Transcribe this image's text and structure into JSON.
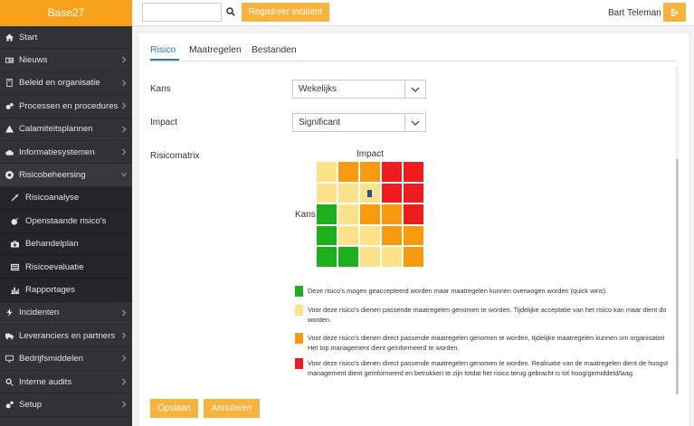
{
  "brand": "Base27",
  "sidebar": {
    "items": [
      {
        "label": "Start",
        "icon": "home-icon",
        "chevron": false
      },
      {
        "label": "Nieuws",
        "icon": "newspaper-icon",
        "chevron": true
      },
      {
        "label": "Beleid en organisatie",
        "icon": "book-icon",
        "chevron": true
      },
      {
        "label": "Processen en procedures",
        "icon": "cogs-icon",
        "chevron": true
      },
      {
        "label": "Calamiteitsplannen",
        "icon": "warning-icon",
        "chevron": true
      },
      {
        "label": "Informatiesystemen",
        "icon": "cloud-icon",
        "chevron": true
      },
      {
        "label": "Risicobeheersing",
        "icon": "lifebuoy-icon",
        "chevron": true,
        "open": true
      }
    ],
    "subitems": [
      {
        "label": "Risicoanalyse",
        "icon": "eyedropper-icon"
      },
      {
        "label": "Openstaande risico's",
        "icon": "bomb-icon"
      },
      {
        "label": "Behandelplan",
        "icon": "medkit-icon"
      },
      {
        "label": "Risicoevaluatie",
        "icon": "list-icon"
      },
      {
        "label": "Rapportages",
        "icon": "chart-icon"
      }
    ],
    "items_after": [
      {
        "label": "Incidenten",
        "icon": "bolt-icon",
        "chevron": true
      },
      {
        "label": "Leveranciers en partners",
        "icon": "truck-icon",
        "chevron": true
      },
      {
        "label": "Bedrijfsmiddelen",
        "icon": "desktop-icon",
        "chevron": true
      },
      {
        "label": "Interne audits",
        "icon": "search-icon",
        "chevron": true
      },
      {
        "label": "Setup",
        "icon": "gears-icon",
        "chevron": true
      }
    ]
  },
  "topbar": {
    "search_value": "",
    "register_label": "Registreer incident",
    "user_name": "Bart Teleman"
  },
  "tabs": [
    "Risico",
    "Maatregelen",
    "Bestanden"
  ],
  "form": {
    "kans_label": "Kans",
    "kans_value": "Wekelijks",
    "impact_label": "Impact",
    "impact_value": "Significant",
    "matrix_label": "Risicomatrix"
  },
  "matrix": {
    "title": "Impact",
    "ylabel": "Kans",
    "colors": {
      "G": "#1db01d",
      "Y": "#fde28a",
      "O": "#f89a0e",
      "R": "#ee1c1c"
    },
    "rows": [
      [
        "Y",
        "O",
        "O",
        "R",
        "R"
      ],
      [
        "Y",
        "Y",
        "Y",
        "R",
        "R"
      ],
      [
        "G",
        "Y",
        "O",
        "O",
        "R"
      ],
      [
        "G",
        "Y",
        "Y",
        "O",
        "O"
      ],
      [
        "G",
        "G",
        "Y",
        "Y",
        "O"
      ]
    ],
    "marker": {
      "row": 1,
      "col": 2
    }
  },
  "legend": [
    {
      "color": "#1db01d",
      "lines": [
        "Deze risico's mogen geaccepteerd worden maar maatregelen kunnen overwogen worden (quick wins)."
      ]
    },
    {
      "color": "#fde28a",
      "lines": [
        "Voor deze risico's dienen passende maatregelen genomen te worden. Tijdelijke acceptatie van het risico kan maar dient do",
        "worden."
      ]
    },
    {
      "color": "#f89a0e",
      "lines": [
        "Voor deze risico's dienen direct passende maatregelen genomen te worden, tijdelijke maatregelen kunnen om organisatori",
        "Het top management dient geïnformeerd te worden."
      ]
    },
    {
      "color": "#ee1c1c",
      "lines": [
        "Voor deze risico's dienen direct passende maatregelen genomen te worden. Realisatie van de maatregelen dient de hoogst",
        "management dient geïnformeerd en betrokken te zijn totdat het risico terug gebracht is tot hoog/gemiddeld/laag."
      ]
    }
  ],
  "buttons": {
    "save": "Opslaan",
    "cancel": "Annuleren"
  }
}
